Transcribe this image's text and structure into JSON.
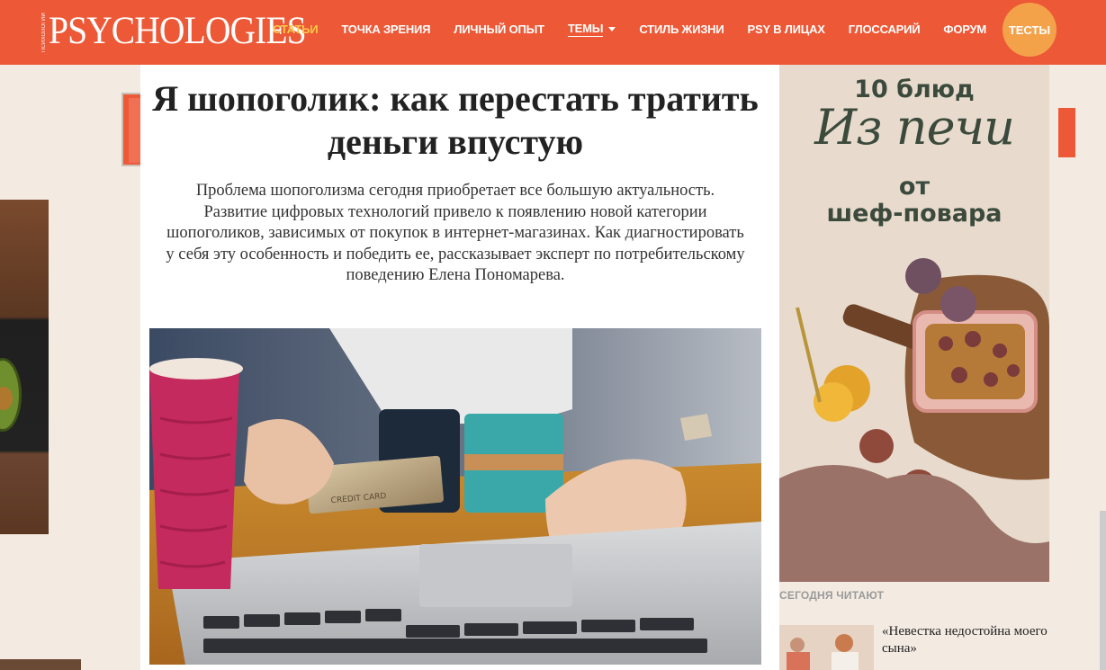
{
  "header": {
    "logo_small": "ПСИХОЛОГИИ",
    "logo": "PSYCHOLOGIES",
    "nav": [
      {
        "label": "СТАТЬИ",
        "active": true
      },
      {
        "label": "ТОЧКА ЗРЕНИЯ"
      },
      {
        "label": "ЛИЧНЫЙ ОПЫТ"
      },
      {
        "label": "ТЕМЫ",
        "dropdown": true
      },
      {
        "label": "СТИЛЬ ЖИЗНИ"
      },
      {
        "label": "PSY В ЛИЦАХ"
      },
      {
        "label": "ГЛОССАРИЙ"
      },
      {
        "label": "ФОРУМ"
      }
    ],
    "tests_label": "ТЕСТЫ"
  },
  "article": {
    "title": "Я шопоголик: как перестать тратить деньги впустую",
    "lead": "Проблема шопоголизма сегодня приобретает все большую актуальность. Развитие цифровых технологий привело к появлению новой категории шопоголиков, зависимых от покупок в интернет-магазинах. Как диагностировать у себя эту особенность и победить ее, рассказывает эксперт по потребительскому поведению Елена Пономарева.",
    "card_text": "CREDIT CARD"
  },
  "ad": {
    "line1": "10 блюд",
    "line2": "Из печи",
    "line3": "от",
    "line4": "шеф-повара"
  },
  "sidebar": {
    "section_label": "СЕГОДНЯ ЧИТАЮТ",
    "read_item": "«Невестка недостойна моего сына»"
  },
  "colors": {
    "brand": "#ed5836",
    "active_nav": "#fbc84a",
    "tests_button": "#f4a24a"
  }
}
